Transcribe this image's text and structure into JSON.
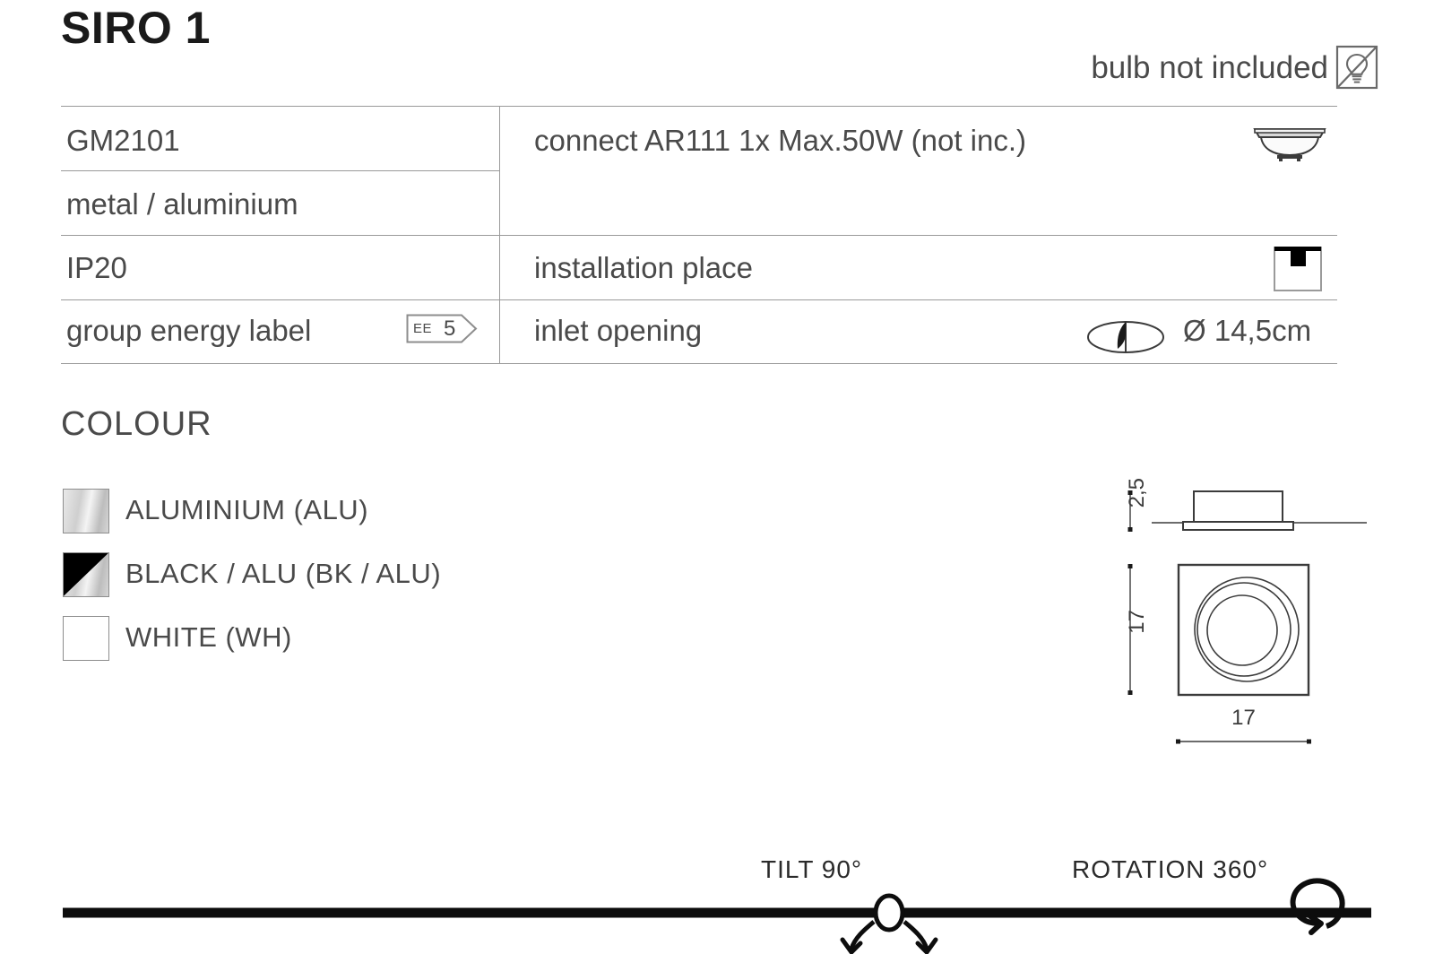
{
  "header": {
    "title": "SIRO 1",
    "bulb_note": "bulb not included",
    "bulb_icon": "bulb-not-included-icon"
  },
  "spec_table": {
    "rows": [
      {
        "left_label": "GM2101",
        "right_label": "connect AR111 1x Max.50W (not inc.)",
        "right_icon": "ar111-lamp-icon"
      },
      {
        "left_label": "metal / aluminium",
        "right_label": "",
        "right_icon": ""
      },
      {
        "left_label": "IP20",
        "right_label": "installation place",
        "right_icon": "ceiling-mount-icon"
      },
      {
        "left_label": "group energy label",
        "right_label": "inlet opening",
        "right_icon": "inlet-opening-icon",
        "right_value": "Ø 14,5cm"
      }
    ],
    "energy_label": {
      "prefix": "EE",
      "value": "5"
    }
  },
  "colour": {
    "heading": "COLOUR",
    "options": [
      {
        "label": "ALUMINIUM (ALU)",
        "swatch": "aluminium"
      },
      {
        "label": "BLACK / ALU (BK / ALU)",
        "swatch": "black-alu"
      },
      {
        "label": "WHITE (WH)",
        "swatch": "white"
      }
    ]
  },
  "drawings": {
    "side_view": {
      "height_dim": "2,5"
    },
    "front_view": {
      "height_dim": "17",
      "width_dim": "17"
    }
  },
  "motion": {
    "tilt_label": "TILT 90°",
    "rotation_label": "ROTATION 360°",
    "tilt_icon": "tilt-pivot-icon",
    "rotation_icon": "rotation-circular-arrow-icon"
  },
  "colors": {
    "ink": "#3b3b3b",
    "rule": "#9a9a9a",
    "black": "#000000"
  }
}
